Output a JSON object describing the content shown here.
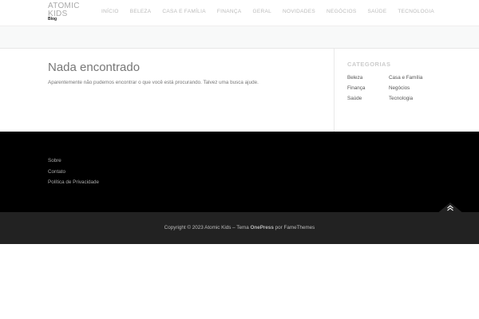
{
  "header": {
    "brand_title": "ATOMIC KIDS",
    "brand_tagline": "Blog",
    "nav": [
      "INÍCIO",
      "BELEZA",
      "CASA E FAMÍLIA",
      "FINANÇA",
      "GERAL",
      "NOVIDADES",
      "NEGÓCIOS",
      "SAÚDE",
      "TECNOLOGIA"
    ]
  },
  "main": {
    "title": "Nada encontrado",
    "message": "Aparentemente não pudemos encontrar o que você está procurando. Talvez uma busca ajude."
  },
  "sidebar": {
    "widget_title": "CATEGORIAS",
    "categories": [
      "Beleza",
      "Casa e Família",
      "Finança",
      "Negócios",
      "Saúde",
      "Tecnologia"
    ]
  },
  "footer": {
    "links": [
      "Sobre",
      "Contato",
      "Política de Privacidade"
    ],
    "copyright_prefix": "Copyright © 2023 Atomic Kids – Tema ",
    "theme_name": "OnePress",
    "by_text": " por ",
    "author": "FameThemes"
  },
  "colors": {
    "footer_bg": "#000000",
    "site_info_bg": "#222222",
    "title_band_bg": "#f8f9f9"
  },
  "icons": {
    "back_to_top": "double-chevron-up-icon"
  }
}
